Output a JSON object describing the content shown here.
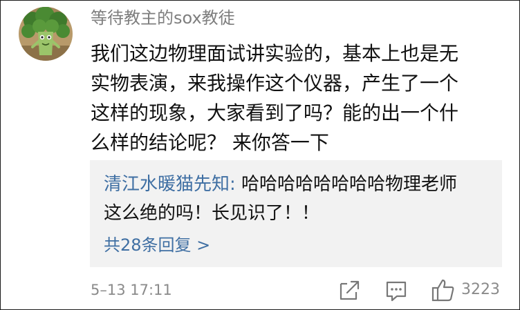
{
  "comment": {
    "username": "等待教主的sox教徒",
    "lines": [
      "我们这边物理面试讲实验的，基本上也是无",
      "实物表演，来我操作这个仪器，产生了一个",
      "这样的现象，大家看到了吗？能的出一个什",
      "么样的结论呢？ 来你答一下"
    ],
    "timestamp": "5–13 17:11",
    "like_count": "3223"
  },
  "reply": {
    "username": "清江水暖猫先知:",
    "lines": [
      " 哈哈哈哈哈哈哈哈物理老师",
      "这么绝的吗！长见识了！！"
    ],
    "more_replies": "共28条回复 >"
  },
  "icons": {
    "share": "share-icon",
    "comment": "comment-icon",
    "like": "thumbs-up-icon",
    "avatar": "broccoli-avatar"
  },
  "colors": {
    "link": "#3f6fa3",
    "muted": "#8a8a8a",
    "reply_bg": "#f2f2f2",
    "text": "#111111"
  }
}
